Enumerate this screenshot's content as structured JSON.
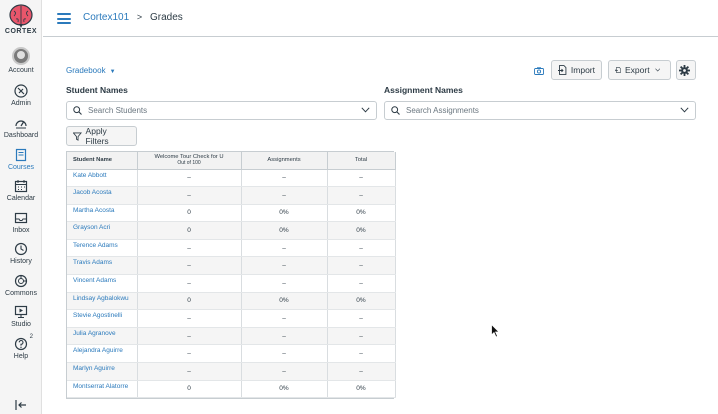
{
  "nav": {
    "logo_text": "CORTEX",
    "items": [
      {
        "label": "Account",
        "icon": "avatar"
      },
      {
        "label": "Admin",
        "icon": "shield-icon"
      },
      {
        "label": "Dashboard",
        "icon": "dashboard-icon"
      },
      {
        "label": "Courses",
        "icon": "book-icon",
        "active": true
      },
      {
        "label": "Calendar",
        "icon": "calendar-icon"
      },
      {
        "label": "Inbox",
        "icon": "inbox-icon"
      },
      {
        "label": "History",
        "icon": "clock-icon"
      },
      {
        "label": "Commons",
        "icon": "commons-icon"
      },
      {
        "label": "Studio",
        "icon": "studio-icon"
      },
      {
        "label": "Help",
        "icon": "help-icon",
        "badge": "2"
      }
    ],
    "collapse_icon": "collapse-icon"
  },
  "breadcrumb": {
    "course": "Cortex101",
    "separator": ">",
    "current": "Grades"
  },
  "toolbar": {
    "gradebook_menu": "Gradebook",
    "import_label": "Import",
    "export_label": "Export"
  },
  "filters": {
    "student_label": "Student Names",
    "student_placeholder": "Search Students",
    "assignment_label": "Assignment Names",
    "assignment_placeholder": "Search Assignments",
    "apply_label": "Apply Filters"
  },
  "grid": {
    "columns": {
      "name": "Student Name",
      "welcome": "Welcome Tour Check for U",
      "welcome_sub": "Out of 100",
      "assignments": "Assignments",
      "total": "Total"
    },
    "rows": [
      {
        "name": "Kate Abbott",
        "welcome": "–",
        "assignments": "–",
        "total": "–"
      },
      {
        "name": "Jacob Acosta",
        "welcome": "–",
        "assignments": "–",
        "total": "–"
      },
      {
        "name": "Martha Acosta",
        "welcome": "0",
        "assignments": "0%",
        "total": "0%"
      },
      {
        "name": "Grayson Acri",
        "welcome": "0",
        "assignments": "0%",
        "total": "0%"
      },
      {
        "name": "Terence Adams",
        "welcome": "–",
        "assignments": "–",
        "total": "–"
      },
      {
        "name": "Travis Adams",
        "welcome": "–",
        "assignments": "–",
        "total": "–"
      },
      {
        "name": "Vincent Adams",
        "welcome": "–",
        "assignments": "–",
        "total": "–"
      },
      {
        "name": "Lindsay Agbalokwu",
        "welcome": "0",
        "assignments": "0%",
        "total": "0%"
      },
      {
        "name": "Stevie Agostinelli",
        "welcome": "–",
        "assignments": "–",
        "total": "–"
      },
      {
        "name": "Julia Agranove",
        "welcome": "–",
        "assignments": "–",
        "total": "–"
      },
      {
        "name": "Alejandra Aguirre",
        "welcome": "–",
        "assignments": "–",
        "total": "–"
      },
      {
        "name": "Marlyn Aguirre",
        "welcome": "–",
        "assignments": "–",
        "total": "–"
      },
      {
        "name": "Montserrat Alatorre",
        "welcome": "0",
        "assignments": "0%",
        "total": "0%"
      }
    ]
  },
  "colors": {
    "accent": "#2b7abc",
    "text": "#2d3b45",
    "border": "#c7cdd1"
  }
}
